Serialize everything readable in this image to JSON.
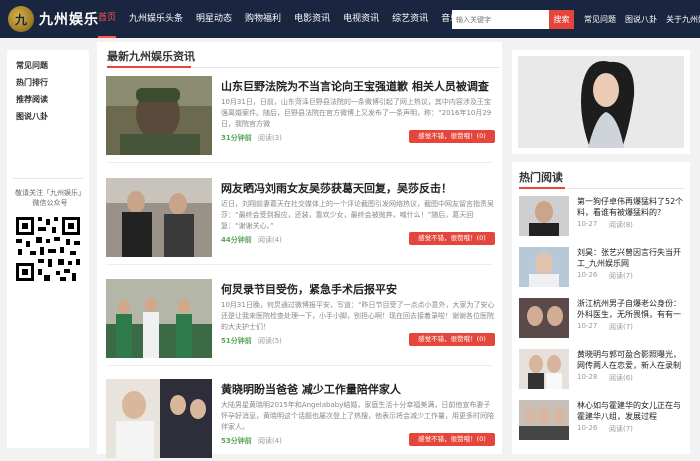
{
  "header": {
    "logo_text": "九州娱乐",
    "nav": [
      "首页",
      "九州娱乐头条",
      "明星动态",
      "购物福利",
      "电影资讯",
      "电视资讯",
      "综艺资讯",
      "音乐天地"
    ],
    "search_placeholder": "输入关键字",
    "search_button": "搜索",
    "links": [
      "常见问题",
      "图说八卦",
      "关于九州娱乐"
    ]
  },
  "sidebar": {
    "items": [
      "常见问题",
      "热门排行",
      "推荐阅读",
      "图说八卦"
    ],
    "follow_text": "敬请关注「九州娱乐」微信公众号"
  },
  "main": {
    "section_title": "最新九州娱乐资讯",
    "articles": [
      {
        "title": "山东巨野法院为不当言论向王宝强道歉 相关人员被调查",
        "summary": "10月31日，日前，山东菏泽巨野县法院的一条微博引起了网上热议，其中内容涉及王宝强离婚案件。随后，巨野县法院在官方微博上又发布了一条声明，称：“2016年10月29日，我院官方微",
        "time": "31分钟前",
        "read": "阅读(3)",
        "like": "感觉不错，很赞哦！(0)"
      },
      {
        "title": "网友晒冯刘雨女友吴莎获葛天回复，吴莎反击！",
        "summary": "近日，刘翔前妻葛天在社交媒体上的一个评论截图引发网络热议，截图中网友留言指责吴莎：“最终会受到报应，还装，靠欢少女，最终会被抛弃，喊什么！”随后，葛天回复：“谢谢关心。”",
        "time": "44分钟前",
        "read": "阅读(4)",
        "like": "感觉不错，很赞哦！(0)"
      },
      {
        "title": "何炅录节目受伤，紧急手术后报平安",
        "summary": "10月31日晚，何炅通过微博报平安，写道：“昨日节目受了一点点小意外，大家为了安心还是让我来医院检查处理一下，小手小脚，别担心啊！现在回去接着录啦！谢谢各位医院的大夫护士们！",
        "time": "51分钟前",
        "read": "阅读(5)",
        "like": "感觉不错，很赞哦！(0)"
      },
      {
        "title": "黄晓明盼当爸爸 减少工作量陪伴家人",
        "summary": "大陆男星黄晓明2015年和Angelababy结婚，家庭生活十分幸福美满，日前他宣布妻子怀孕好消息，黄晓明这个话题也屡次登上了热搜，他表示将会减少工作量，用更多时间陪伴家人。",
        "time": "53分钟前",
        "read": "阅读(4)",
        "like": "感觉不错，很赞哦！(0)"
      }
    ]
  },
  "right": {
    "hot_title": "热门阅读",
    "hot_items": [
      {
        "title": "第一狗仔卓伟再爆猛料了52个料，看谁有被爆猛料的？",
        "date": "10-27",
        "read": "阅读(8)"
      },
      {
        "title": "刘昊：张艺兴曾因言行失当开工_九州娱乐网",
        "date": "10-26",
        "read": "阅读(7)"
      },
      {
        "title": "浙江杭州男子自爆老公身份：外科医生，无所畏惧，有有一文",
        "date": "10-27",
        "read": "阅读(7)"
      },
      {
        "title": "黄晓明与郭可盈合影照曝光，网传两人在恋爱，新人在录制综艺",
        "date": "10-28",
        "read": "阅读(6)"
      },
      {
        "title": "林心如与霍建华的女儿正在与霍建华八组，发展过程",
        "date": "10-26",
        "read": "阅读(7)"
      }
    ]
  }
}
